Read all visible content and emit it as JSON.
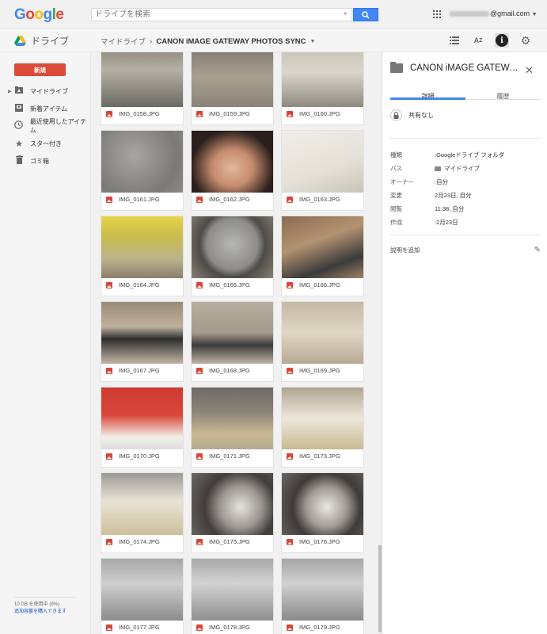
{
  "header": {
    "logo_letters": [
      {
        "ch": "G",
        "color": "#4285f4"
      },
      {
        "ch": "o",
        "color": "#ea4335"
      },
      {
        "ch": "o",
        "color": "#fbbc05"
      },
      {
        "ch": "g",
        "color": "#4285f4"
      },
      {
        "ch": "l",
        "color": "#34a853"
      },
      {
        "ch": "e",
        "color": "#ea4335"
      }
    ],
    "search_placeholder": "ドライブを検索",
    "account_suffix": "@gmail.com"
  },
  "subbar": {
    "app_name": "ドライブ",
    "breadcrumb_root": "マイドライブ",
    "breadcrumb_current": "CANON iMAGE GATEWAY PHOTOS SYNC"
  },
  "sidebar": {
    "new_button": "新規",
    "items": [
      {
        "label": "マイドライブ",
        "icon": "my-drive-icon"
      },
      {
        "label": "新着アイテム",
        "icon": "incoming-icon"
      },
      {
        "label": "最近使用したアイテム",
        "icon": "clock-icon"
      },
      {
        "label": "スター付き",
        "icon": "star-icon"
      },
      {
        "label": "ゴミ箱",
        "icon": "trash-icon"
      }
    ],
    "storage_usage": "10 GB を使用中 (9%)",
    "buy_storage": "追加容量を購入できます"
  },
  "files": [
    {
      "name": "IMG_0158.JPG"
    },
    {
      "name": "IMG_0159.JPG"
    },
    {
      "name": "IMG_0160.JPG"
    },
    {
      "name": "IMG_0161.JPG"
    },
    {
      "name": "IMG_0162.JPG"
    },
    {
      "name": "IMG_0163.JPG"
    },
    {
      "name": "IMG_0164.JPG"
    },
    {
      "name": "IMG_0165.JPG"
    },
    {
      "name": "IMG_0166.JPG"
    },
    {
      "name": "IMG_0167.JPG"
    },
    {
      "name": "IMG_0168.JPG"
    },
    {
      "name": "IMG_0169.JPG"
    },
    {
      "name": "IMG_0170.JPG"
    },
    {
      "name": "IMG_0171.JPG"
    },
    {
      "name": "IMG_0173.JPG"
    },
    {
      "name": "IMG_0174.JPG"
    },
    {
      "name": "IMG_0175.JPG"
    },
    {
      "name": "IMG_0176.JPG"
    },
    {
      "name": "IMG_0177.JPG"
    },
    {
      "name": "IMG_0178.JPG"
    },
    {
      "name": "IMG_0179.JPG"
    }
  ],
  "details": {
    "title": "CANON iMAGE GATEWA…",
    "tab_details": "詳細",
    "tab_activity": "履歴",
    "sharing": "共有なし",
    "props": [
      {
        "key": "種類",
        "value": ":Googleドライブ フォルダ"
      },
      {
        "key": "パス",
        "value": "マイドライブ",
        "folder": true
      },
      {
        "key": "オーナー",
        "value": ":自分"
      },
      {
        "key": "変更",
        "value": "2月23日, 自分"
      },
      {
        "key": "閲覧",
        "value": "11:38, 自分"
      },
      {
        "key": "作成",
        "value": ":2月23日"
      }
    ],
    "add_description": "説明を追加"
  }
}
